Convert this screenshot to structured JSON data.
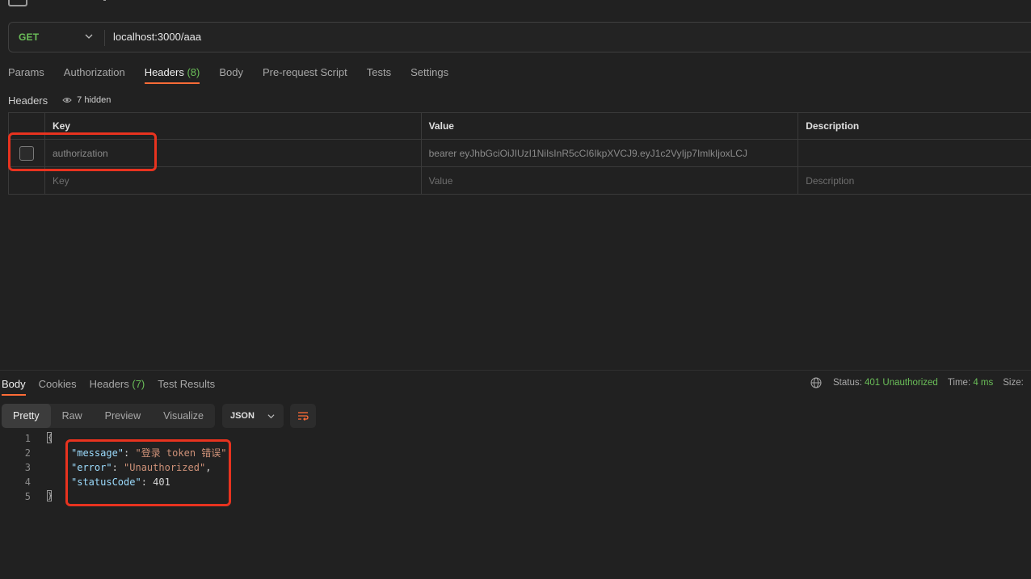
{
  "request": {
    "method": "GET",
    "url": "localhost:3000/aaa"
  },
  "request_tabs": [
    {
      "label": "Params"
    },
    {
      "label": "Authorization"
    },
    {
      "label": "Headers",
      "count": "(8)"
    },
    {
      "label": "Body"
    },
    {
      "label": "Pre-request Script"
    },
    {
      "label": "Tests"
    },
    {
      "label": "Settings"
    }
  ],
  "headers_section": {
    "title": "Headers",
    "hidden_label": "7 hidden"
  },
  "headers_table": {
    "columns": {
      "key": "Key",
      "value": "Value",
      "description": "Description"
    },
    "rows": [
      {
        "key": "authorization",
        "value": "bearer eyJhbGciOiJIUzI1NiIsInR5cCI6IkpXVCJ9.eyJ1c2VyIjp7ImlkIjoxLCJ",
        "description": ""
      }
    ],
    "placeholders": {
      "key": "Key",
      "value": "Value",
      "description": "Description"
    }
  },
  "response_tabs": [
    {
      "label": "Body"
    },
    {
      "label": "Cookies"
    },
    {
      "label": "Headers",
      "count": "(7)"
    },
    {
      "label": "Test Results"
    }
  ],
  "status": {
    "status_label": "Status:",
    "status_value": "401 Unauthorized",
    "time_label": "Time:",
    "time_value": "4 ms",
    "size_label": "Size:"
  },
  "view_modes": [
    "Pretty",
    "Raw",
    "Preview",
    "Visualize"
  ],
  "format_select": "JSON",
  "code": {
    "line_numbers": [
      "1",
      "2",
      "3",
      "4",
      "5"
    ],
    "open_brace": "{",
    "close_brace": "}",
    "k1": "\"message\"",
    "v1": "\"登录 token 错误\"",
    "k2": "\"error\"",
    "v2": "\"Unauthorized\"",
    "k3": "\"statusCode\"",
    "v3": "401",
    "colon": ": ",
    "comma": ","
  },
  "colors": {
    "accent": "#ff6c37",
    "green": "#6bbf59",
    "annotation": "#e8331f"
  }
}
